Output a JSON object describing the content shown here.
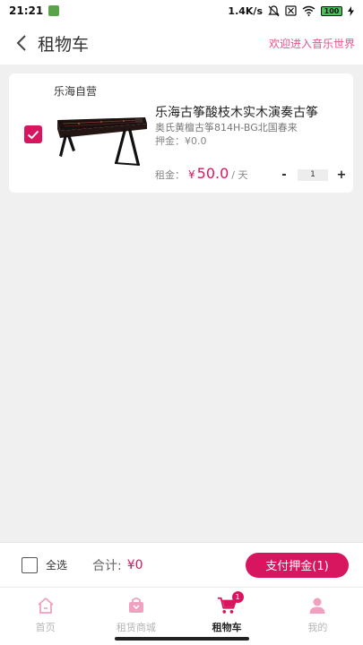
{
  "status_bar": {
    "time": "21:21",
    "speed": "1.4K/s",
    "battery": "100"
  },
  "header": {
    "title": "租物车",
    "welcome": "欢迎进入音乐世界"
  },
  "cart": {
    "shop_name": "乐海自营",
    "item": {
      "checked": true,
      "title": "乐海古筝酸枝木实木演奏古筝",
      "spec": "奥氏黄檀古筝814H-BG北国春来",
      "deposit_label": "押金：",
      "deposit_value": "¥0.0",
      "rent_label": "租金：",
      "rent_currency": "¥",
      "rent_price": "50.0",
      "rent_unit": "/ 天",
      "quantity": "1",
      "minus": "-",
      "plus": "+"
    }
  },
  "bottom_bar": {
    "select_all_label": "全选",
    "total_label": "合计:",
    "total_value": "¥0",
    "pay_button": "支付押金(1)"
  },
  "tabs": [
    {
      "label": "首页",
      "icon": "home-icon",
      "active": false
    },
    {
      "label": "租赁商城",
      "icon": "shop-bag-icon",
      "active": false
    },
    {
      "label": "租物车",
      "icon": "cart-icon",
      "active": true,
      "badge": "1"
    },
    {
      "label": "我的",
      "icon": "user-icon",
      "active": false
    }
  ],
  "colors": {
    "accent": "#d8165f",
    "welcome": "#e8528f",
    "inactive_tab": "#f2a0bf"
  }
}
